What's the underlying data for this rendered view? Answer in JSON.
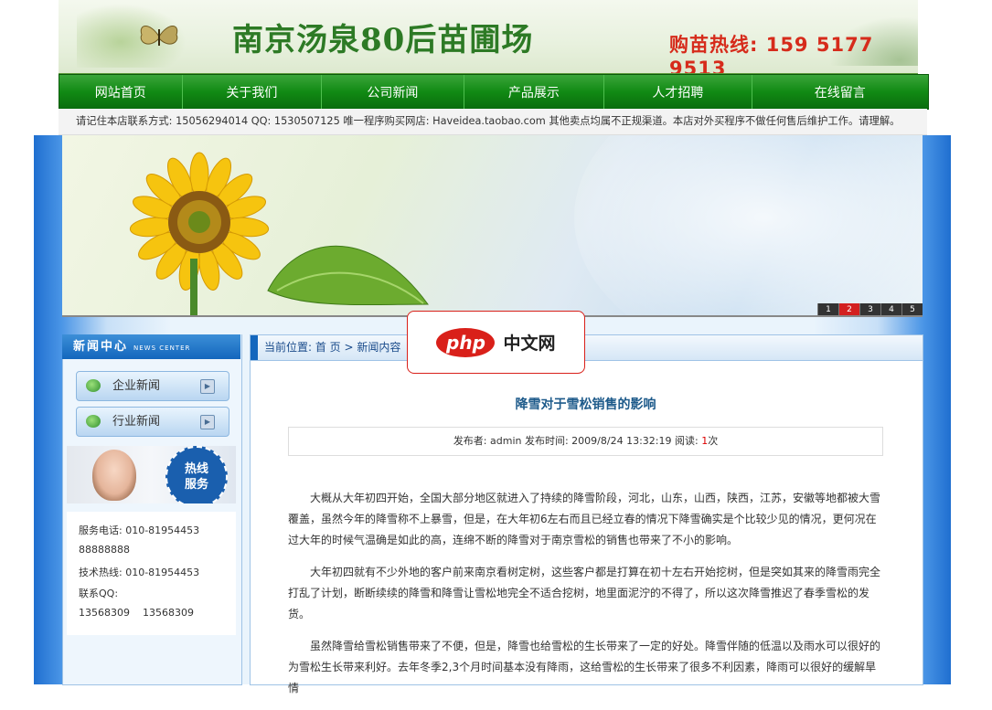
{
  "header": {
    "title": "南京汤泉80后苗圃场",
    "hotline": "购苗热线: 159 5177 9513"
  },
  "nav": {
    "items": [
      {
        "label": "网站首页"
      },
      {
        "label": "关于我们"
      },
      {
        "label": "公司新闻"
      },
      {
        "label": "产品展示"
      },
      {
        "label": "人才招聘"
      },
      {
        "label": "在线留言"
      }
    ]
  },
  "notice": "请记住本店联系方式: 15056294014 QQ: 1530507125 唯一程序购买网店: Haveidea.taobao.com 其他卖点均属不正规渠道。本店对外买程序不做任何售后维护工作。请理解。",
  "slider": {
    "pages": [
      "1",
      "2",
      "3",
      "4",
      "5"
    ],
    "active": "2"
  },
  "sidebar": {
    "title": "新闻中心",
    "title_en": "NEWS CENTER",
    "categories": [
      {
        "label": "企业新闻"
      },
      {
        "label": "行业新闻"
      }
    ],
    "hotline_badge": [
      "热线",
      "服务"
    ],
    "contact": {
      "service_phone_label": "服务电话: 010-81954453",
      "service_phone_extra": "88888888",
      "tech_hotline": "技术热线: 010-81954453",
      "qq_label": "联系QQ:",
      "qq_values": "13568309    13568309"
    }
  },
  "breadcrumb": "当前位置: 首 页 > 新闻内容",
  "article": {
    "title": "降雪对于雪松销售的影响",
    "meta_prefix": "发布者: admin 发布时间: 2009/8/24 13:32:19 阅读: ",
    "reads": "1",
    "meta_suffix": "次",
    "paragraphs": [
      "大概从大年初四开始，全国大部分地区就进入了持续的降雪阶段，河北，山东，山西，陕西，江苏，安徽等地都被大雪覆盖，虽然今年的降雪称不上暴雪，但是，在大年初6左右而且已经立春的情况下降雪确实是个比较少见的情况，更何况在过大年的时候气温确是如此的高，连绵不断的降雪对于南京雪松的销售也带来了不小的影响。",
      "大年初四就有不少外地的客户前来南京看树定树，这些客户都是打算在初十左右开始挖树，但是突如其来的降雪雨完全打乱了计划，断断续续的降雪和降雪让雪松地完全不适合挖树，地里面泥泞的不得了，所以这次降雪推迟了春季雪松的发货。",
      "虽然降雪给雪松销售带来了不便，但是，降雪也给雪松的生长带来了一定的好处。降雪伴随的低温以及雨水可以很好的为雪松生长带来利好。去年冬季2,3个月时间基本没有降雨，这给雪松的生长带来了很多不利因素，降雨可以很好的缓解旱情"
    ]
  },
  "overlay": {
    "pill": "php",
    "text": "中文网"
  },
  "colors": {
    "nav_green": "#118a14",
    "title_green": "#2d7a25",
    "hotline_red": "#d62b1b",
    "accent_blue": "#1366bd"
  }
}
